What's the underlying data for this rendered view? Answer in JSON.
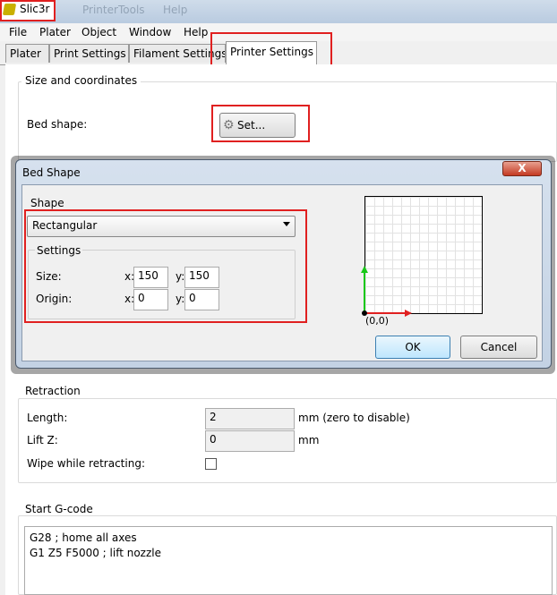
{
  "app": {
    "title": "Slic3r"
  },
  "faded_menu": [
    "Printer",
    "Tools",
    "Help"
  ],
  "menu": [
    "File",
    "Plater",
    "Object",
    "Window",
    "Help"
  ],
  "tabs": [
    {
      "label": "Plater",
      "active": false
    },
    {
      "label": "Print Settings",
      "active": false
    },
    {
      "label": "Filament Settings",
      "active": false
    },
    {
      "label": "Printer Settings",
      "active": true
    }
  ],
  "size_group": {
    "title": "Size and coordinates",
    "bed_shape_label": "Bed shape:",
    "set_button": "Set..."
  },
  "dialog": {
    "title": "Bed Shape",
    "close": "X",
    "shape_label": "Shape",
    "shape_value": "Rectangular",
    "settings_label": "Settings",
    "size_label": "Size:",
    "origin_label": "Origin:",
    "x_label": "x:",
    "y_label": "y:",
    "size_x": "150",
    "size_y": "150",
    "origin_x": "0",
    "origin_y": "0",
    "origin_text": "(0,0)",
    "ok": "OK",
    "cancel": "Cancel"
  },
  "retraction": {
    "title": "Retraction",
    "length_label": "Length:",
    "length_value": "2",
    "length_unit": "mm (zero to disable)",
    "liftz_label": "Lift Z:",
    "liftz_value": "0",
    "liftz_unit": "mm",
    "wipe_label": "Wipe while retracting:"
  },
  "gcode": {
    "title": "Start G-code",
    "line1": "G28 ; home all axes",
    "line2": "G1 Z5 F5000 ; lift nozzle"
  },
  "colors": {
    "highlight": "#e02020",
    "axis_x": "#e02020",
    "axis_y": "#18c818"
  }
}
